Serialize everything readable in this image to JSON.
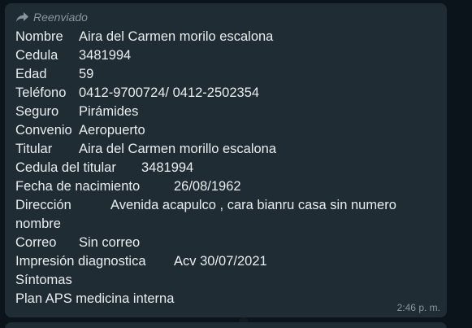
{
  "message": {
    "forwarded_label": "Reenviado",
    "time": "2:46 p. m.",
    "rows": {
      "nombre": {
        "label": "Nombre",
        "value": "Aira del Carmen morilo escalona"
      },
      "cedula": {
        "label": "Cedula",
        "value": "3481994"
      },
      "edad": {
        "label": "Edad",
        "value": "59"
      },
      "telefono": {
        "label": "Teléfono",
        "value": "0412-9700724/ 0412-2502354"
      },
      "seguro": {
        "label": "Seguro",
        "value": "Pirámides"
      },
      "convenio": {
        "label": "Convenio",
        "value": "Aeropuerto"
      },
      "titular": {
        "label": "Titular",
        "value": "Aira del Carmen morillo escalona"
      },
      "cedula_titular": {
        "label": "Cedula del titular",
        "value": "3481994"
      },
      "fecha_nacimiento": {
        "label": "Fecha de nacimiento",
        "value": "26/08/1962"
      },
      "direccion": {
        "label": "Dirección",
        "value": "Avenida acapulco , cara bianru casa sin numero",
        "continuation": "nombre"
      },
      "correo": {
        "label": "Correo",
        "value": "Sin correo"
      },
      "impresion": {
        "label": "Impresión diagnostica",
        "value": "Acv 30/07/2021"
      },
      "sintomas": {
        "label": "Síntomas"
      },
      "plan": {
        "label": "Plan APS medicina interna"
      }
    }
  },
  "colors": {
    "background": "#0b141a",
    "bubble": "#202c33",
    "text": "#e9edef",
    "meta": "#8696a0"
  },
  "icons": {
    "forwarded": "forward-arrow-icon"
  }
}
